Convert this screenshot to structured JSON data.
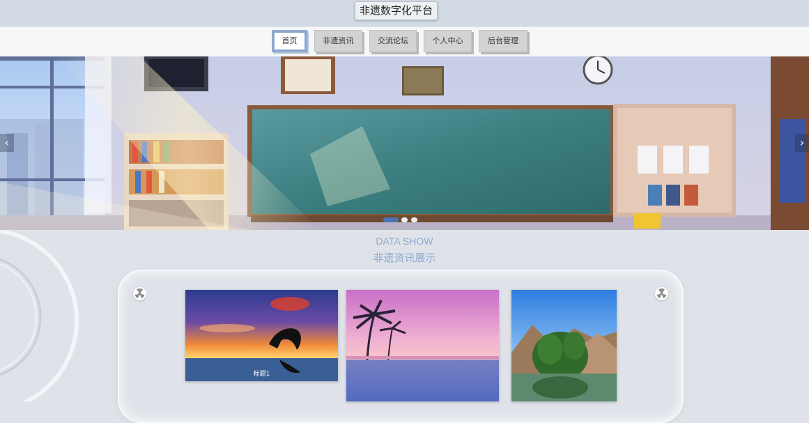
{
  "header": {
    "title": "非遗数字化平台"
  },
  "nav": {
    "items": [
      {
        "label": "首页",
        "active": true
      },
      {
        "label": "非遗资讯",
        "active": false
      },
      {
        "label": "交流论坛",
        "active": false
      },
      {
        "label": "个人中心",
        "active": false
      },
      {
        "label": "后台管理",
        "active": false
      }
    ]
  },
  "carousel": {
    "prev_icon": "chevron-left-icon",
    "next_icon": "chevron-right-icon",
    "prev_glyph": "‹",
    "next_glyph": "›",
    "slide_count": 3,
    "active_slide": 1
  },
  "section": {
    "title_en": "DATA SHOW",
    "title_zh": "非遗资讯展示"
  },
  "cards": [
    {
      "caption": "标题1"
    },
    {
      "caption": ""
    },
    {
      "caption": ""
    }
  ],
  "colors": {
    "accent": "#8ea8cc",
    "nav_button": "#d3d3d3",
    "page_background": "#dfe3e9"
  }
}
